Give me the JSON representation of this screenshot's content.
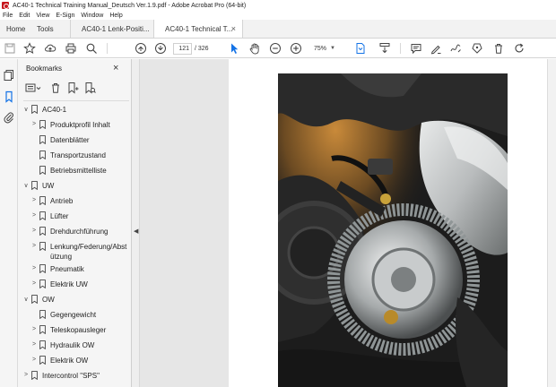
{
  "window": {
    "title": "AC40-1 Technical Training Manual_Deutsch Ver.1.9.pdf - Adobe Acrobat Pro (64-bit)"
  },
  "menu": [
    "File",
    "Edit",
    "View",
    "E-Sign",
    "Window",
    "Help"
  ],
  "tabs": {
    "home": "Home",
    "tools": "Tools",
    "doc1": "AC40-1 Lenk-Positi...",
    "doc2": "AC40-1 Technical T...",
    "close": "×"
  },
  "toolbar": {
    "page_current": "121",
    "page_total": "/ 326",
    "zoom": "75%"
  },
  "bookmarks": {
    "header": "Bookmarks",
    "close": "×",
    "items": [
      {
        "label": "AC40-1",
        "level": 0,
        "chevron": "∨"
      },
      {
        "label": "Produktprofil Inhalt",
        "level": 1,
        "chevron": ">"
      },
      {
        "label": "Datenblätter",
        "level": 1,
        "chevron": ""
      },
      {
        "label": "Transportzustand",
        "level": 1,
        "chevron": ""
      },
      {
        "label": "Betriebsmittelliste",
        "level": 1,
        "chevron": ""
      },
      {
        "label": "UW",
        "level": 0,
        "chevron": "∨"
      },
      {
        "label": "Antrieb",
        "level": 1,
        "chevron": ">"
      },
      {
        "label": "Lüfter",
        "level": 1,
        "chevron": ">"
      },
      {
        "label": "Drehdurchführung",
        "level": 1,
        "chevron": ">"
      },
      {
        "label": "Lenkung/Federung/Abst",
        "label2": "ützung",
        "level": 1,
        "chevron": ">"
      },
      {
        "label": "Pneumatik",
        "level": 1,
        "chevron": ">"
      },
      {
        "label": "Elektrik UW",
        "level": 1,
        "chevron": ">"
      },
      {
        "label": "OW",
        "level": 0,
        "chevron": "∨"
      },
      {
        "label": "Gegengewicht",
        "level": 1,
        "chevron": ""
      },
      {
        "label": "Teleskopausleger",
        "level": 1,
        "chevron": ">"
      },
      {
        "label": "Hydraulik OW",
        "level": 1,
        "chevron": ">"
      },
      {
        "label": "Elektrik OW",
        "level": 1,
        "chevron": ">"
      },
      {
        "label": "Intercontrol \"SPS\"",
        "level": 0,
        "chevron": ">"
      }
    ]
  },
  "colors": {
    "accent_blue": "#1473e6",
    "acrobat_red": "#c7161d"
  }
}
